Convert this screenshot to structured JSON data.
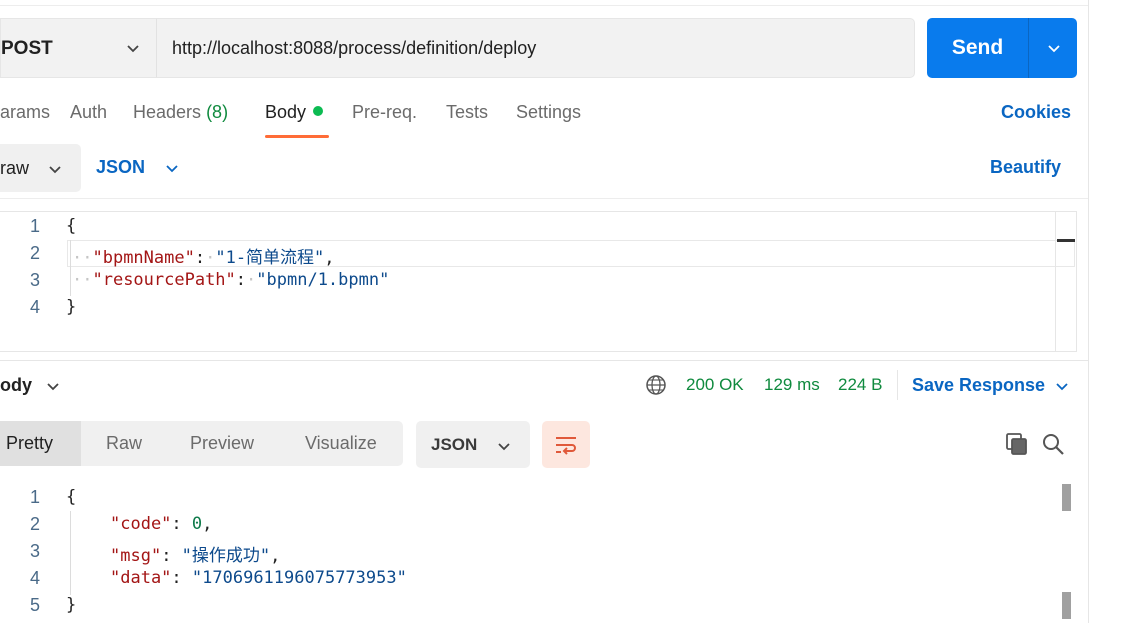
{
  "request": {
    "method": "POST",
    "url": "http://localhost:8088/process/definition/deploy",
    "send_label": "Send"
  },
  "request_tabs": {
    "params": "arams",
    "auth": "Auth",
    "headers": "Headers",
    "headers_count": "(8)",
    "body": "Body",
    "prereq": "Pre-req.",
    "tests": "Tests",
    "settings": "Settings",
    "cookies": "Cookies"
  },
  "body_options": {
    "mode": "raw",
    "language": "JSON",
    "beautify": "Beautify"
  },
  "request_body": {
    "line_numbers": [
      "1",
      "2",
      "3",
      "4"
    ],
    "open_brace": "{",
    "close_brace": "}",
    "k1": "\"bpmnName\"",
    "v1": "\"1-简单流程\"",
    "k2": "\"resourcePath\"",
    "v2": "\"bpmn/1.bpmn\""
  },
  "response_bar": {
    "body_label": "ody",
    "status": "200 OK",
    "time": "129 ms",
    "size": "224 B",
    "save": "Save Response"
  },
  "response_views": {
    "pretty": "Pretty",
    "raw": "Raw",
    "preview": "Preview",
    "visualize": "Visualize",
    "language": "JSON"
  },
  "response_body": {
    "line_numbers": [
      "1",
      "2",
      "3",
      "4",
      "5"
    ],
    "open_brace": "{",
    "close_brace": "}",
    "k1": "\"code\"",
    "v1": "0",
    "k2": "\"msg\"",
    "v2": "\"操作成功\"",
    "k3": "\"data\"",
    "v3": "\"1706961196075773953\""
  },
  "colors": {
    "accent": "#097bed",
    "active_tab_underline": "#ff6c37",
    "status_ok": "#0f8a3e",
    "link": "#0a66c2"
  }
}
